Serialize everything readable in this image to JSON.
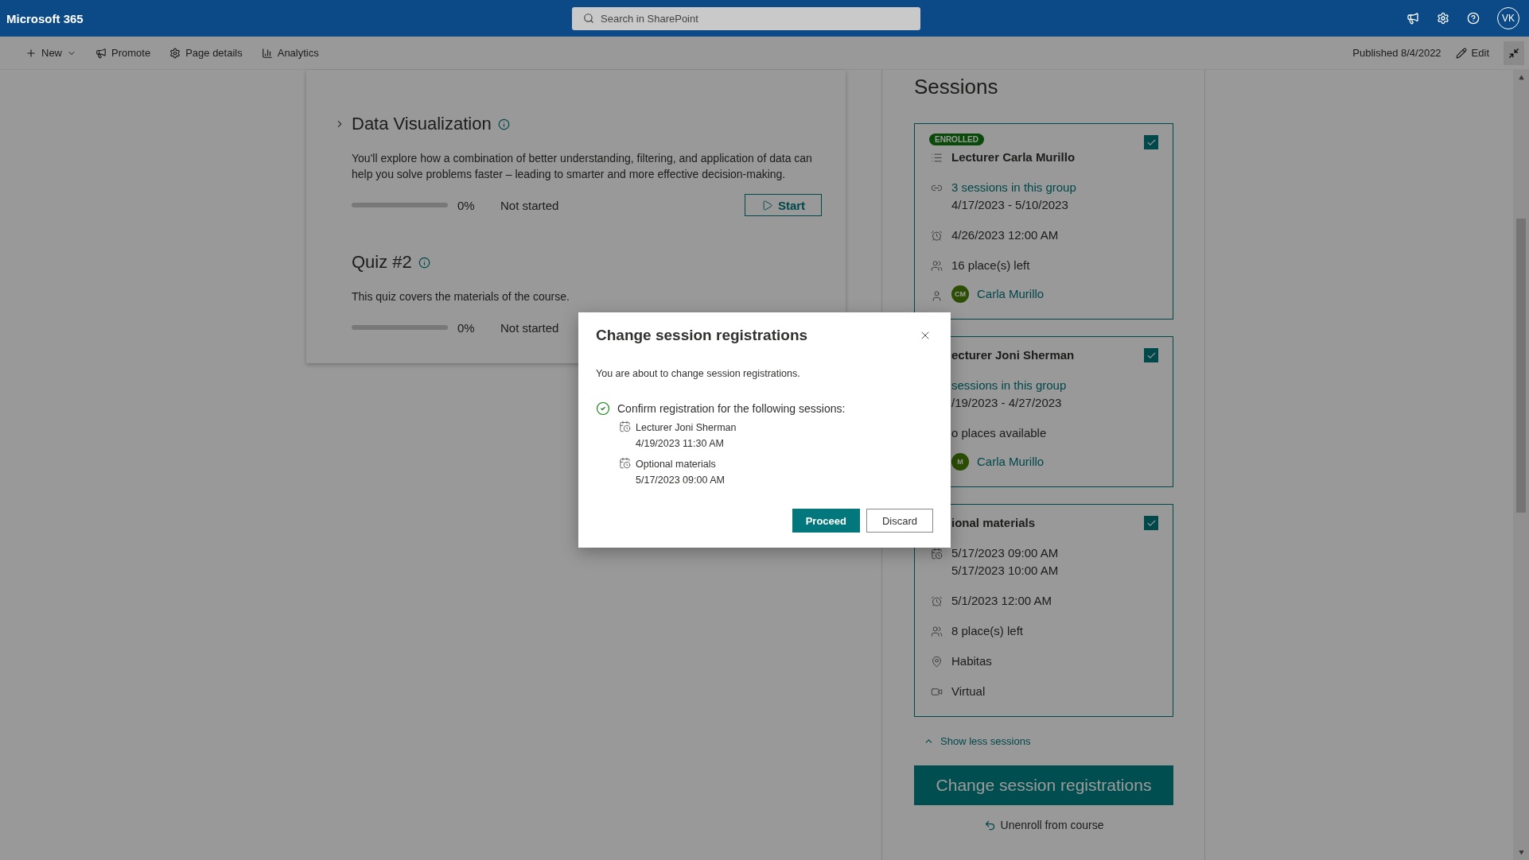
{
  "suite_bar": {
    "app_name": "Microsoft 365",
    "search": {
      "placeholder": "Search in SharePoint"
    },
    "avatar": "VK"
  },
  "command_bar": {
    "items": [
      {
        "label": "New",
        "kind": "new"
      },
      {
        "label": "Promote",
        "kind": "promote"
      },
      {
        "label": "Page details",
        "kind": "details"
      },
      {
        "label": "Analytics",
        "kind": "analytics"
      }
    ],
    "published": "Published 8/4/2022",
    "edit": "Edit"
  },
  "modules": [
    {
      "title": "Data Visualization",
      "expandable": true,
      "description": "You'll explore how a combination of better understanding, filtering, and application of data can help you solve problems faster – leading to smarter and more effective decision-making.",
      "level": 0,
      "percent": "0%",
      "status": "Not started",
      "action": "Start"
    },
    {
      "title": "Quiz #2",
      "expandable": false,
      "description": "This quiz covers the materials of the course.",
      "level": 0,
      "percent": "0%",
      "status": "Not started"
    }
  ],
  "sessions": {
    "heading": "Sessions",
    "cards": [
      {
        "kind": "list",
        "badge": "ENROLLED",
        "checked": true,
        "title": "Lecturer Carla Murillo",
        "rows": [
          {
            "kind": "group",
            "lines": [
              "3 sessions in this group",
              "4/17/2023 - 5/10/2023"
            ]
          },
          {
            "kind": "deadline",
            "lines": [
              "4/26/2023 12:00 AM"
            ]
          },
          {
            "kind": "places",
            "lines": [
              "16 place(s) left"
            ]
          },
          {
            "kind": "instructor",
            "avatar": "CM",
            "lines": [
              "Carla Murillo"
            ]
          }
        ]
      },
      {
        "kind": "plain",
        "checked": true,
        "title": "ecturer Joni Sherman",
        "rows": [
          {
            "kind": "linktext",
            "lines": [
              "sessions in this group",
              "/19/2023 - 4/27/2023"
            ]
          },
          {
            "kind": "text",
            "lines": [
              "o places available"
            ]
          },
          {
            "kind": "person",
            "avatar": "M",
            "lines": [
              "Carla Murillo"
            ]
          }
        ]
      },
      {
        "kind": "plain",
        "checked": true,
        "title": "ional materials",
        "rows": [
          {
            "kind": "datetime",
            "lines": [
              "5/17/2023 09:00 AM",
              "5/17/2023 10:00 AM"
            ]
          },
          {
            "kind": "deadline",
            "lines": [
              "5/1/2023 12:00 AM"
            ]
          },
          {
            "kind": "places",
            "lines": [
              "8 place(s) left"
            ]
          },
          {
            "kind": "location",
            "lines": [
              "Habitas"
            ]
          },
          {
            "kind": "mode",
            "lines": [
              "Virtual"
            ]
          }
        ]
      }
    ],
    "show_less": "Show less sessions",
    "primary_button": "Change session registrations",
    "unenroll": "Unenroll from course"
  },
  "dialog": {
    "title": "Change session registrations",
    "message": "You are about to change session registrations.",
    "confirm": "Confirm registration for the following sessions:",
    "items": [
      {
        "name": "Lecturer Joni Sherman",
        "time": "4/19/2023 11:30 AM"
      },
      {
        "name": "Optional materials",
        "time": "5/17/2023 09:00 AM"
      }
    ],
    "buttons": [
      {
        "label": "Proceed",
        "kind": "primary"
      },
      {
        "label": "Discard",
        "kind": "secondary"
      }
    ]
  }
}
